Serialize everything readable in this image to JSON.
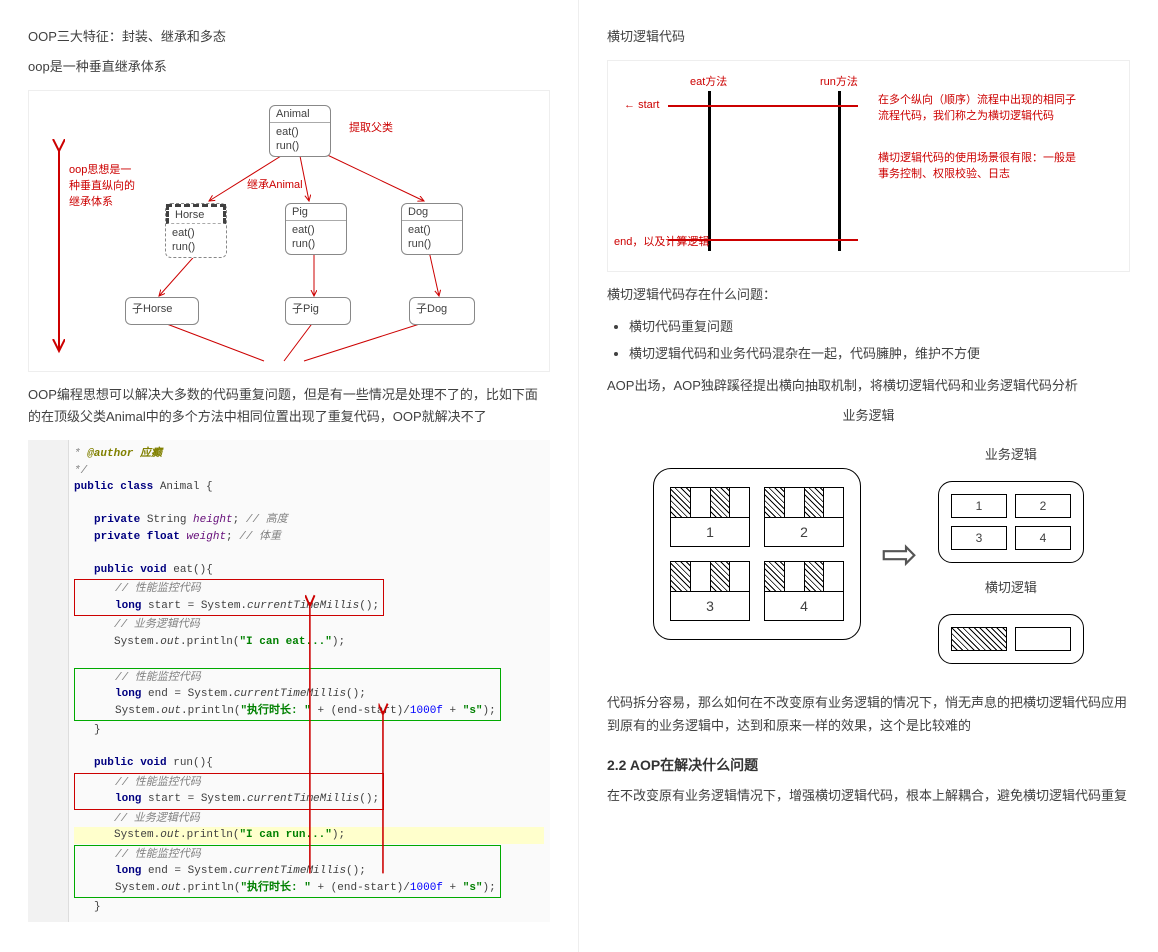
{
  "left": {
    "p1": "OOP三大特征：封装、继承和多态",
    "p2": "oop是一种垂直继承体系",
    "d1": {
      "side": "oop思想是一种垂直纵向的继承体系",
      "animal": "Animal",
      "methods": "eat()\nrun()",
      "extract": "提取父类",
      "inherit": "继承Animal",
      "horse": "Horse",
      "pig": "Pig",
      "dog": "Dog",
      "sub_prefix": "子"
    },
    "p3": "OOP编程思想可以解决大多数的代码重复问题，但是有一些情况是处理不了的，比如下面的在顶级父类Animal中的多个方法中相同位置出现了重复代码，OOP就解决不了",
    "code": {
      "author": "@author 应癫",
      "cls": "public class Animal {",
      "f1": "private String height; // 高度",
      "f2": "private float weight;  // 体重",
      "eat_sig": "public void eat(){",
      "perf": "// 性能监控代码",
      "start": "long start = System.currentTimeMillis();",
      "biz": "// 业务逻辑代码",
      "eat_print": "System.out.println(\"I can eat...\");",
      "end": "long end = System.currentTimeMillis();",
      "dur": "System.out.println(\"执行时长: \" + (end-start)/1000f + \"s\");",
      "run_sig": "public void run(){",
      "run_print": "System.out.println(\"I can run...\");"
    }
  },
  "right": {
    "h1": "横切逻辑代码",
    "d2": {
      "eat": "eat方法",
      "run": "run方法",
      "start": "start",
      "end": "end，以及计算逻辑",
      "note1": "在多个纵向（顺序）流程中出现的相同子流程代码，我们称之为横切逻辑代码",
      "note2": "横切逻辑代码的使用场景很有限：一般是事务控制、权限校验、日志"
    },
    "p1": "横切逻辑代码存在什么问题：",
    "b1": "横切代码重复问题",
    "b2": "横切逻辑代码和业务代码混杂在一起，代码臃肿，维护不方便",
    "p2": "AOP出场，AOP独辟蹊径提出横向抽取机制，将横切逻辑代码和业务逻辑代码分析",
    "d3": {
      "t_biz": "业务逻辑",
      "t_cross": "横切逻辑"
    },
    "p3": "代码拆分容易，那么如何在不改变原有业务逻辑的情况下，悄无声息的把横切逻辑代码应用到原有的业务逻辑中，达到和原来一样的效果，这个是比较难的",
    "h2": "2.2 AOP在解决什么问题",
    "p4": "在不改变原有业务逻辑情况下，增强横切逻辑代码，根本上解耦合，避免横切逻辑代码重复"
  }
}
